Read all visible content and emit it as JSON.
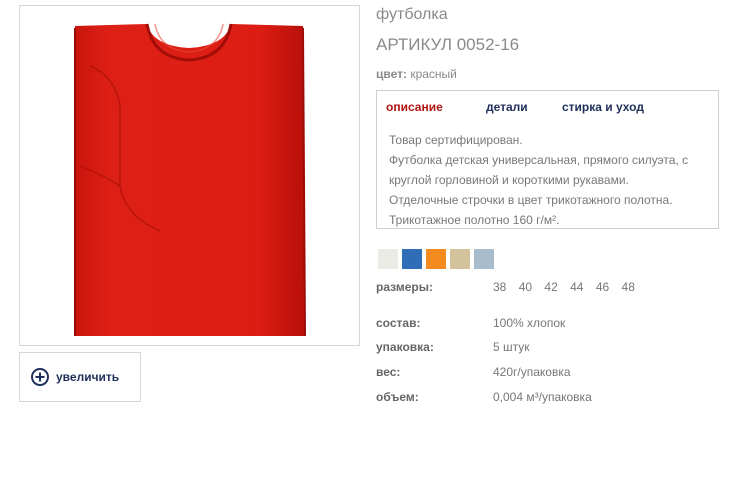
{
  "product": {
    "title": "футболка",
    "article": "АРТИКУЛ 0052-16",
    "color_label": "цвет:",
    "color_value": "красный"
  },
  "zoom": {
    "label": "увеличить",
    "icon": "plus-circle-icon"
  },
  "tabs": [
    {
      "label": "описание",
      "active": true
    },
    {
      "label": "детали",
      "active": false
    },
    {
      "label": "стирка и уход",
      "active": false
    }
  ],
  "description": [
    "Товар сертифицирован.",
    "Футболка детская универсальная, прямого силуэта, с",
    "круглой горловиной и короткими рукавами.",
    "Отделочные строчки в цвет трикотажного полотна.",
    "Трикотажное полотно 160 г/м²."
  ],
  "swatch_colors": [
    "#ebebe6",
    "#2f6db6",
    "#f48b1f",
    "#d2c39d",
    "#a9bccb"
  ],
  "specs": {
    "sizes_label": "размеры:",
    "sizes": [
      "38",
      "40",
      "42",
      "44",
      "46",
      "48"
    ],
    "composition_label": "состав:",
    "composition_value": "100% хлопок",
    "packaging_label": "упаковка:",
    "packaging_value": "5 штук",
    "weight_label": "вес:",
    "weight_value": "420г/упаковка",
    "volume_label": "объем:",
    "volume_value": "0,004 м³/упаковка"
  },
  "colors": {
    "shirt": "#db1d14",
    "accent_red": "#b31212",
    "dark_blue": "#1f2f5a"
  }
}
